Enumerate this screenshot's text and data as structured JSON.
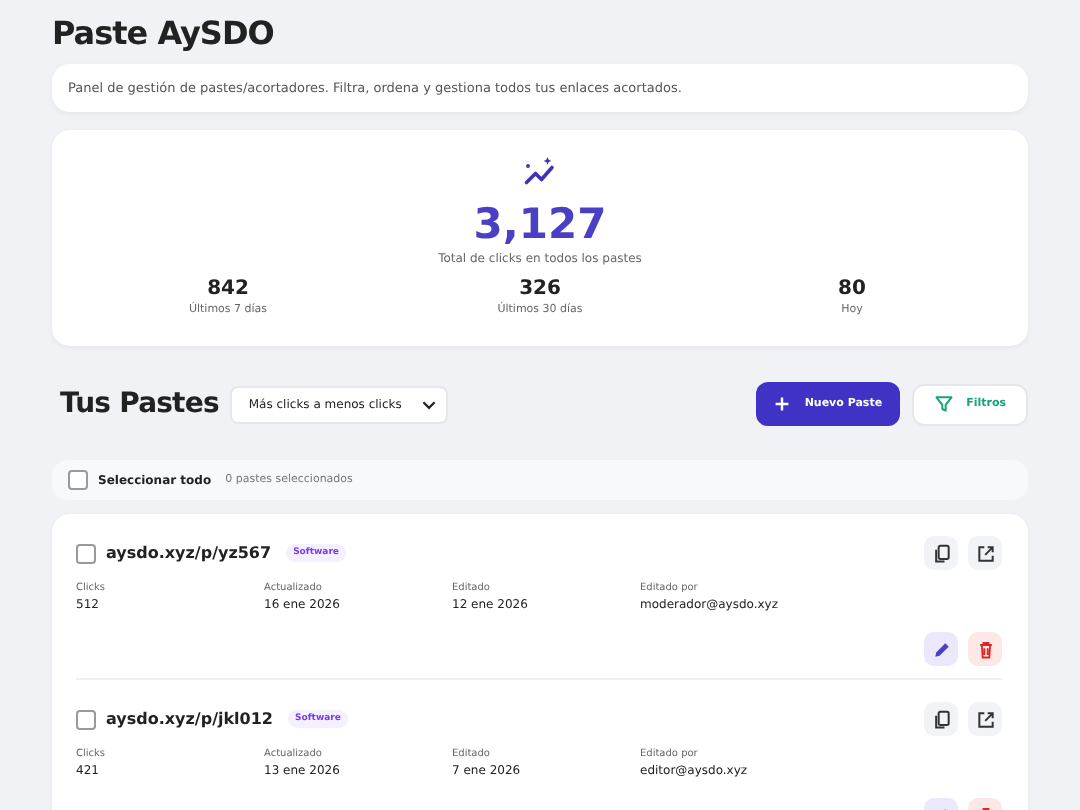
{
  "title": "Paste AySDO",
  "description": "Panel de gestión de pastes/acortadores. Filtra, ordena y gestiona todos tus enlaces acortados.",
  "stats": {
    "total": "3,127",
    "total_label": "Total de clicks en todos los pastes",
    "periods": [
      {
        "value": "842",
        "label": "Últimos 7 días"
      },
      {
        "value": "326",
        "label": "Últimos 30 días"
      },
      {
        "value": "80",
        "label": "Hoy"
      }
    ]
  },
  "toolbar": {
    "heading": "Tus Pastes",
    "sort": "Más clicks a menos clicks",
    "new_button": "Nuevo Paste",
    "filter_button": "Filtros"
  },
  "selection": {
    "label": "Seleccionar todo",
    "checked": false,
    "count": "0 pastes seleccionados"
  },
  "pastes": [
    {
      "url": "aysdo.xyz/p/yz567",
      "tag": "Software",
      "checked": false,
      "fields": [
        {
          "label": "Clicks",
          "value": "512"
        },
        {
          "label": "Actualizado",
          "value": "16 ene 2026"
        },
        {
          "label": "Editado",
          "value": "12 ene 2026"
        },
        {
          "label": "Editado por",
          "value": "moderador@aysdo.xyz"
        }
      ]
    },
    {
      "url": "aysdo.xyz/p/jkl012",
      "tag": "Software",
      "checked": false,
      "fields": [
        {
          "label": "Clicks",
          "value": "421"
        },
        {
          "label": "Actualizado",
          "value": "13 ene 2026"
        },
        {
          "label": "Editado",
          "value": "7 ene 2026"
        },
        {
          "label": "Editado por",
          "value": "editor@aysdo.xyz"
        }
      ]
    }
  ]
}
